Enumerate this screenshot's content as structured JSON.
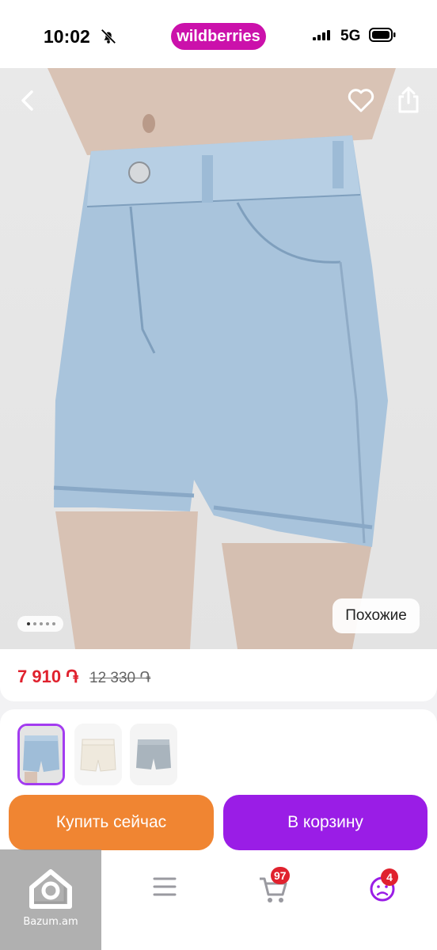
{
  "status_bar": {
    "time": "10:02",
    "app_pill": "wildberries",
    "network": "5G"
  },
  "hero": {
    "similar_label": "Похожие",
    "pagination_total": 5,
    "pagination_current": 1
  },
  "price": {
    "current": "7 910 ֏",
    "old": "12 330 ֏",
    "current_color": "#e0222e"
  },
  "variants": {
    "items": [
      {
        "name": "light-blue-denim",
        "selected": true
      },
      {
        "name": "white-denim",
        "selected": false
      },
      {
        "name": "grey-denim",
        "selected": false
      }
    ]
  },
  "actions": {
    "buy_now": "Купить сейчас",
    "add_to_cart": "В корзину",
    "buy_color": "#f08532",
    "cart_color": "#9a1de6"
  },
  "tabbar": {
    "items": [
      {
        "icon": "home-icon"
      },
      {
        "icon": "menu-icon"
      },
      {
        "icon": "cart-icon",
        "badge": "97"
      },
      {
        "icon": "profile-icon",
        "badge": "4"
      }
    ]
  },
  "watermark": {
    "text": "Bazum.am"
  }
}
